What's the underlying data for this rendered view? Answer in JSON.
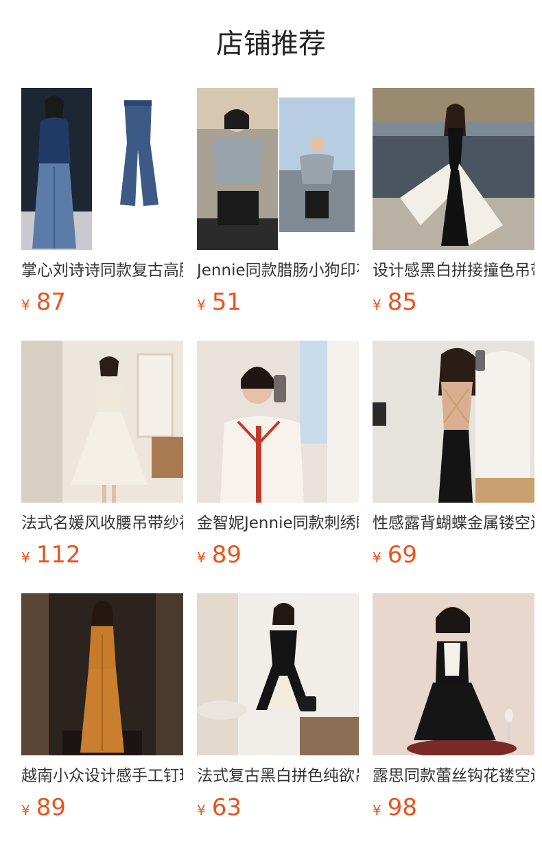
{
  "header": {
    "title": "店铺推荐"
  },
  "currency_symbol": "¥",
  "colors": {
    "price": "#e8541e",
    "text": "#333333"
  },
  "products": [
    {
      "name": "掌心刘诗诗同款复古高腰喇叭牛仔裤",
      "price": "87",
      "image": "woman-in-velvet-top-and-flared-jeans"
    },
    {
      "name": "Jennie同款腊肠小狗印花短袖T恤",
      "price": "51",
      "image": "woman-in-grey-tee-and-black-pants"
    },
    {
      "name": "设计感黑白拼接撞色吊带连衣裙",
      "price": "85",
      "image": "woman-in-black-white-flowing-dress"
    },
    {
      "name": "法式名媛风收腰吊带纱裙连衣裙",
      "price": "112",
      "image": "woman-in-white-tulle-dress-mirror-selfie"
    },
    {
      "name": "金智妮Jennie同款刺绣睡衣衬衫",
      "price": "89",
      "image": "woman-in-white-shirt-red-trim"
    },
    {
      "name": "性感露背蝴蝶金属镂空连衣裙",
      "price": "69",
      "image": "woman-in-black-backless-dress"
    },
    {
      "name": "越南小众设计感手工钉珠长裙",
      "price": "89",
      "image": "woman-in-orange-long-dress"
    },
    {
      "name": "法式复古黑白拼色纯欲吊带裙",
      "price": "63",
      "image": "woman-in-black-white-mini-dress"
    },
    {
      "name": "露思同款蕾丝钩花镂空连衣裙",
      "price": "98",
      "image": "woman-in-black-dress-white-lace"
    }
  ]
}
